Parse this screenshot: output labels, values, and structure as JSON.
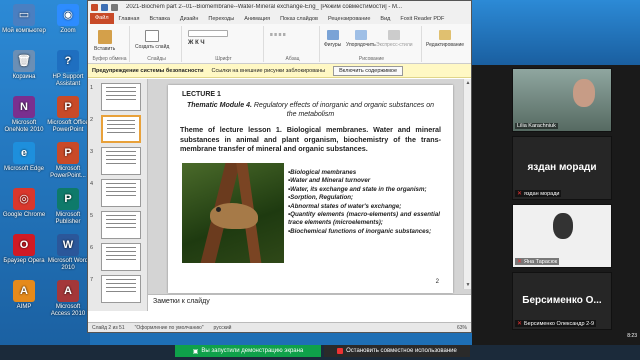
{
  "desktop": {
    "icons": [
      {
        "label": "Мой компьютер",
        "color": "#4a7fc1",
        "glyph": "▭"
      },
      {
        "label": "Zoom",
        "color": "#2d8cff",
        "glyph": "◉"
      },
      {
        "label": "Корзина",
        "color": "#6b8fb5",
        "glyph": "🗑"
      },
      {
        "label": "HP Support Assistant",
        "color": "#1f6fc0",
        "glyph": "?"
      },
      {
        "label": "Microsoft OneNote 2010",
        "color": "#7a2f8f",
        "glyph": "N"
      },
      {
        "label": "Microsoft Office PowerPoint",
        "color": "#c84a28",
        "glyph": "P"
      },
      {
        "label": "Microsoft Edge",
        "color": "#1e8fdc",
        "glyph": "e"
      },
      {
        "label": "Microsoft PowerPoint...",
        "color": "#c84a28",
        "glyph": "P"
      },
      {
        "label": "Google Chrome",
        "color": "#d9372c",
        "glyph": "◎"
      },
      {
        "label": "Microsoft Publisher",
        "color": "#0e7a6a",
        "glyph": "P"
      },
      {
        "label": "Браузер Opera",
        "color": "#d01a25",
        "glyph": "O"
      },
      {
        "label": "Microsoft Word 2010",
        "color": "#2b579a",
        "glyph": "W"
      },
      {
        "label": "AIMP",
        "color": "#e58a1b",
        "glyph": "A"
      },
      {
        "label": "Microsoft Access 2010",
        "color": "#a4373a",
        "glyph": "A"
      }
    ]
  },
  "ppt": {
    "title": "2021-Biochem part 2--01--Biomembrane--Water-Mineral exchange-Eng_ [Режим совместимости] - M...",
    "tabs": [
      "Файл",
      "Главная",
      "Вставка",
      "Дизайн",
      "Переходы",
      "Анимация",
      "Показ слайдов",
      "Рецензирование",
      "Вид",
      "Foxit Reader PDF"
    ],
    "ribbon": {
      "paste": "Вставить",
      "clipboard": "Буфер обмена",
      "create_slide": "Создать слайд",
      "slides": "Слайды",
      "font": "Шрифт",
      "paragraph": "Абзац",
      "shapes": "Фигуры",
      "arrange": "Упорядочить",
      "quick_styles": "Экспресс-стили",
      "drawing": "Рисование",
      "editing": "Редактирование"
    },
    "security": {
      "title": "Предупреждение системы безопасности",
      "message": "Ссылки на внешние рисунки заблокированы",
      "button": "Включить содержимое"
    },
    "slide": {
      "lecture": "LECTURE 1",
      "module_bold": "Thematic Module 4.",
      "module_rest": " Regulatory effects of inorganic and organic substances on the metabolism",
      "theme": "Theme of lecture lesson 1. Biological membranes. Water and mineral substances in animal and plant organism, biochemistry of the trans-membrane transfer of mineral and organic substances.",
      "topics": [
        "•Biological membranes",
        "•Water and Mineral turnover",
        "•Water, its exchange and state in the organism;",
        "•Sorption, Regulation;",
        "•Abnormal states of water's exchange;",
        "•Quantity elements (macro-elements) and essential trace elements (microelements);",
        "•Biochemical functions of inorganic substances;"
      ],
      "page_number": "2"
    },
    "thumb_numbers": [
      "1",
      "2",
      "3",
      "4",
      "5",
      "6",
      "7"
    ],
    "notes_placeholder": "Заметки к слайду",
    "status": {
      "slide_info": "Слайд 2 из 51",
      "theme": "\"Оформление по умолчанию\"",
      "language": "русский",
      "zoom": "63%"
    }
  },
  "zoom": {
    "participants": [
      {
        "name": "Lilia Karachniuk"
      },
      {
        "name": "яздан моради",
        "big": "яздан моради"
      },
      {
        "name": "Яна Тарасюк"
      },
      {
        "name": "Берсименко Олександр 2-9",
        "big": "Берсименко  О..."
      }
    ]
  },
  "share": {
    "sharing_message": "Вы запустили демонстрацию экрана",
    "stop_label": "Остановить совместное использование"
  },
  "clock": {
    "time": "8:23",
    "date": "..."
  }
}
